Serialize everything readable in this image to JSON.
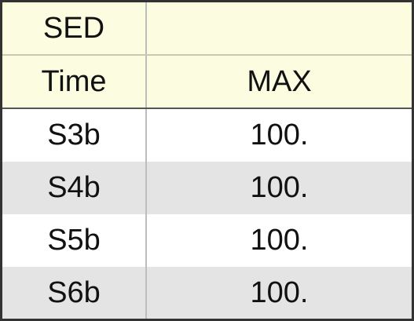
{
  "table": {
    "header": {
      "row1": [
        "SED",
        ""
      ],
      "row2": [
        "Time",
        "MAX"
      ]
    },
    "rows": [
      {
        "time": "S3b",
        "max": "100."
      },
      {
        "time": "S4b",
        "max": "100."
      },
      {
        "time": "S5b",
        "max": "100."
      },
      {
        "time": "S6b",
        "max": "100."
      }
    ]
  },
  "colors": {
    "header_background": "#fcfce0",
    "alt_row_background": "#e4e4e4",
    "border": "#333333"
  }
}
